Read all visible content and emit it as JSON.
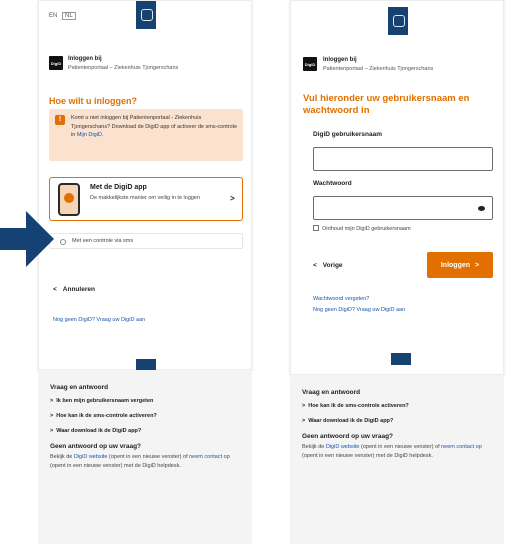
{
  "colors": {
    "orange": "#e17000",
    "navy": "#154273",
    "link": "#1a55a5"
  },
  "left": {
    "lang_a": "EN",
    "lang_b": "NL",
    "logo_text": "DigiD",
    "login_for": "Inloggen bij",
    "provider": "Patientenportaal – Ziekenhuis Tjongerschans",
    "heading": "Hoe wilt u inloggen?",
    "notice": {
      "text": "Komt u niet inloggen bij Patientenportaal - Ziekenhuis Tjongerschans? Download de DigiD app of activeer de sms-controle in",
      "link": "Mijn DigiD."
    },
    "app_option": {
      "title": "Met de DigiD app",
      "subtitle": "De makkelijkste manier om veilig in te loggen"
    },
    "sms_option": "Met een controle via sms",
    "cancel": "Annuleren",
    "no_digid_link": "Nog geen DigiD? Vraag uw DigiD aan"
  },
  "right": {
    "logo_text": "DigiD",
    "login_for": "Inloggen bij",
    "provider": "Patientenportaal – Ziekenhuis Tjongerschans",
    "heading": "Vul hieronder uw gebruikersnaam en wachtwoord in",
    "username_label": "DigiD gebruikersnaam",
    "password_label": "Wachtwoord",
    "remember": "Onthoud mijn DigiD gebruikersnaam",
    "back": "Vorige",
    "login_button": "Inloggen",
    "forgot_link": "Wachtwoord vergeten?",
    "no_digid_link": "Nog geen DigiD? Vraag uw DigiD aan"
  },
  "faq_left": {
    "title": "Vraag en antwoord",
    "items": [
      "Ik ben mijn gebruikersnaam vergeten",
      "Hoe kan ik de sms-controle activeren?",
      "Waar download ik de DigiD app?"
    ],
    "no_answer_title": "Geen antwoord op uw vraag?",
    "text_1": "Bekijk de",
    "link_1": "DigiD website",
    "text_2": "(opent in een nieuwe venster) of",
    "link_2": "neem contact op",
    "text_3": "(opent in een nieuwe venster) met de DigiD helpdesk."
  },
  "faq_right": {
    "title": "Vraag en antwoord",
    "items": [
      "Hoe kan ik de sms-controle activeren?",
      "Waar download ik de DigiD app?"
    ],
    "no_answer_title": "Geen antwoord op uw vraag?",
    "text_1": "Bekijk de",
    "link_1": "DigiD website",
    "text_2": "(opent in een nieuwe venster) of",
    "link_2": "neem contact op",
    "text_3": "(opent in een nieuwe venster) met de DigiD helpdesk."
  }
}
